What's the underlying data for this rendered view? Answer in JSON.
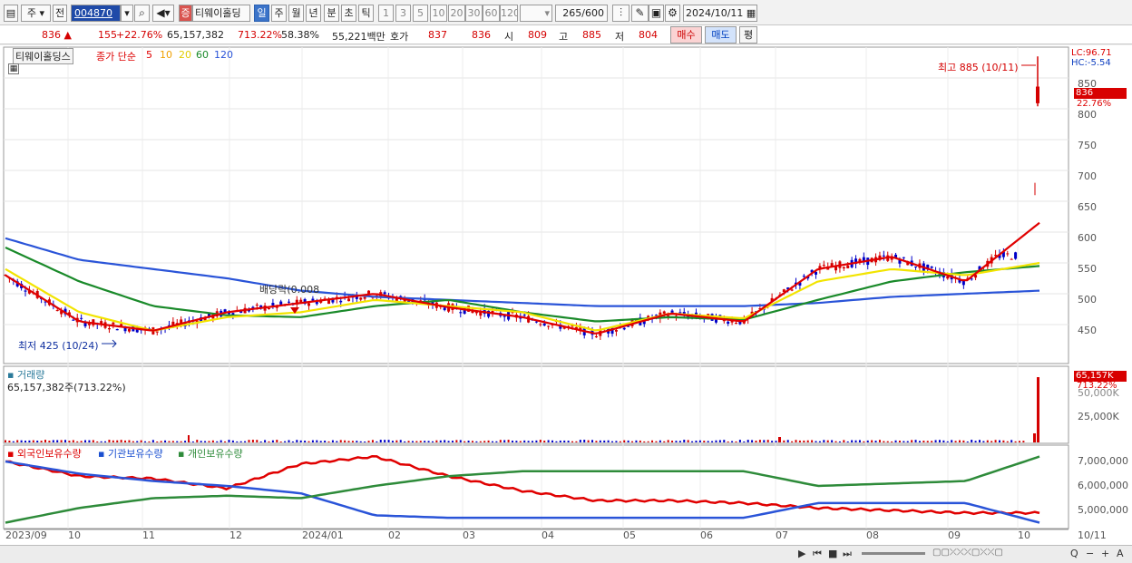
{
  "toolbar": {
    "type_select": "주",
    "prev_label": "전",
    "code_value": "004870",
    "stock_badge": "증",
    "stock_name": "티웨이홀딩",
    "periods": [
      "일",
      "주",
      "월",
      "년",
      "분",
      "초",
      "틱"
    ],
    "active_period": "일",
    "intervals": [
      "1",
      "3",
      "5",
      "10",
      "20",
      "30",
      "60",
      "120"
    ],
    "count": "265",
    "count_total": "/600",
    "date": "2024/10/11"
  },
  "quote": {
    "price": "836",
    "change": "155",
    "change_pct": "+22.76%",
    "volume": "65,157,382",
    "volume_ratio": "713.22%",
    "turnover": "58.38%",
    "amount": "55,221백만",
    "bid_label": "호가",
    "bid1": "837",
    "bid2": "836",
    "open_label": "시",
    "open": "809",
    "high_label": "고",
    "high": "885",
    "low_label": "저",
    "low": "804",
    "buy_label": "매수",
    "sell_label": "매도",
    "eval_label": "평"
  },
  "price_panel": {
    "name_tag": "티웨이홀딩스",
    "ma_label": "종가 단순",
    "ma_periods": [
      "5",
      "10",
      "20",
      "60",
      "120"
    ],
    "lc": "LC:96.71",
    "hc": "HC:-5.54",
    "high_annotation": "최고 885 (10/11)",
    "low_annotation": "최저 425 (10/24)",
    "dividend_annotation": "배당락(0.008",
    "current_tag": "836",
    "current_pct_tag": "22.76%",
    "y_ticks": [
      "850",
      "800",
      "750",
      "700",
      "650",
      "600",
      "550",
      "500",
      "450"
    ]
  },
  "volume_panel": {
    "title": "거래량",
    "value": "65,157,382주(713.22%)",
    "tag": "65,157K",
    "tag_pct": "713.22%",
    "hidden_tick": "50,000K",
    "y_ticks": [
      "25,000K"
    ]
  },
  "holding_panel": {
    "legend": [
      "외국인보유수량",
      "기관보유수량",
      "개인보유수량"
    ],
    "y_ticks": [
      "7,000,000",
      "6,000,000",
      "5,000,000"
    ]
  },
  "x_axis": {
    "labels": [
      "2023/09",
      "10",
      "11",
      "12",
      "2024/01",
      "02",
      "03",
      "04",
      "05",
      "06",
      "07",
      "08",
      "09",
      "10"
    ],
    "right_label": "10/11"
  },
  "colors": {
    "up": "#d40000",
    "down": "#0000c8",
    "ma5": "#e00000",
    "ma10": "#f0a000",
    "ma20": "#f2e400",
    "ma60": "#1a8a2a",
    "ma120": "#2a54d8",
    "foreign": "#e00000",
    "institution": "#2a54d8",
    "individual": "#2e8b3a"
  },
  "chart_data": {
    "type": "line",
    "title": "티웨이홀딩스",
    "x": [
      "2023/09",
      "10",
      "11",
      "12",
      "2024/01",
      "02",
      "03",
      "04",
      "05",
      "06",
      "07",
      "08",
      "09",
      "10",
      "10/11"
    ],
    "series": [
      {
        "name": "120",
        "values": [
          590,
          555,
          540,
          525,
          505,
          495,
          490,
          485,
          480,
          480,
          480,
          485,
          495,
          500,
          505
        ]
      },
      {
        "name": "60",
        "values": [
          575,
          520,
          480,
          465,
          462,
          480,
          490,
          470,
          455,
          462,
          458,
          490,
          520,
          535,
          545
        ]
      },
      {
        "name": "20",
        "values": [
          540,
          470,
          440,
          462,
          470,
          490,
          480,
          470,
          440,
          468,
          460,
          520,
          540,
          530,
          550
        ]
      },
      {
        "name": "5",
        "values": [
          530,
          455,
          440,
          470,
          485,
          500,
          478,
          462,
          435,
          468,
          455,
          540,
          560,
          520,
          615
        ]
      }
    ],
    "ylim": [
      420,
      870
    ],
    "high": {
      "value": 885,
      "date": "10/11"
    },
    "low": {
      "value": 425,
      "date": "10/24"
    },
    "last_close": 836,
    "volume_last": "65,157,382",
    "holdings": [
      {
        "name": "외국인보유수량",
        "values": [
          7000000,
          6400000,
          6300000,
          5900000,
          6900000,
          7200000,
          6400000,
          5800000,
          5400000,
          5400000,
          5300000,
          5100000,
          5000000,
          4900000,
          4900000
        ]
      },
      {
        "name": "기관보유수량",
        "values": [
          7000000,
          6500000,
          6200000,
          6000000,
          5700000,
          4800000,
          4700000,
          4700000,
          4700000,
          4700000,
          4700000,
          5300000,
          5300000,
          5300000,
          4500000
        ]
      },
      {
        "name": "개인보유수량",
        "values": [
          4500000,
          5100000,
          5500000,
          5600000,
          5500000,
          6000000,
          6400000,
          6600000,
          6600000,
          6600000,
          6600000,
          6000000,
          6100000,
          6200000,
          7200000
        ]
      }
    ]
  },
  "bottom": {
    "controls": [
      "▶",
      "⏮",
      "■",
      "⏭"
    ],
    "right_icons": [
      "Q",
      "−",
      "+",
      "A"
    ]
  }
}
